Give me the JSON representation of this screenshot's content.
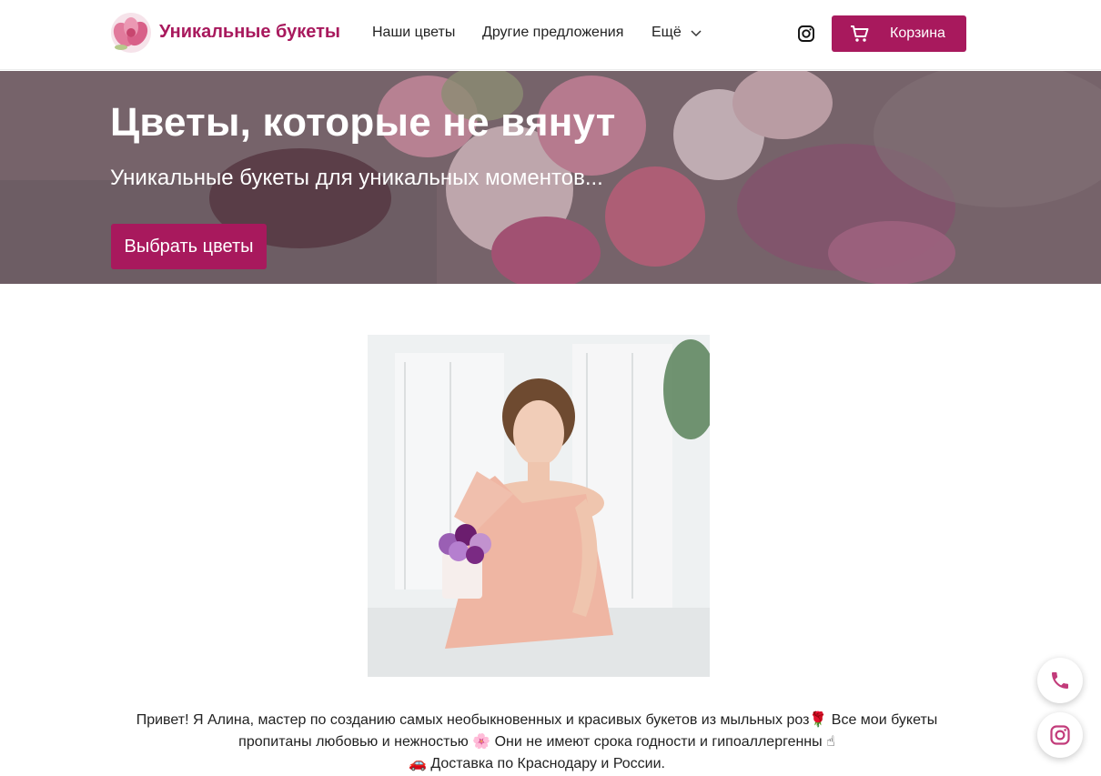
{
  "header": {
    "brand": "Уникальные букеты",
    "nav": [
      "Наши цветы",
      "Другие предложения",
      "Ещё"
    ],
    "cart_label": "Корзина",
    "icons": [
      "logo-flower-icon",
      "chevron-down-icon",
      "instagram-icon",
      "cart-icon"
    ]
  },
  "hero": {
    "title": "Цветы, которые не вянут",
    "subtitle": "Уникальные букеты для уникальных моментов...",
    "button_label": "Выбрать цветы"
  },
  "intro": {
    "line1": "Привет! Я Алина, мастер по созданию самых необыкновенных и красивых букетов из мыльных роз🌹 Все мои букеты",
    "line2": "пропитаны любовью и нежностью 🌸 Они не имеют срока годности и гипоаллергенны ☝",
    "line3": "🚗 Доставка по Краснодару и России."
  },
  "floating": {
    "icons": [
      "phone-icon",
      "instagram-icon"
    ]
  },
  "colors": {
    "accent": "#a8195d",
    "background": "#ffffff",
    "text": "#222222"
  }
}
